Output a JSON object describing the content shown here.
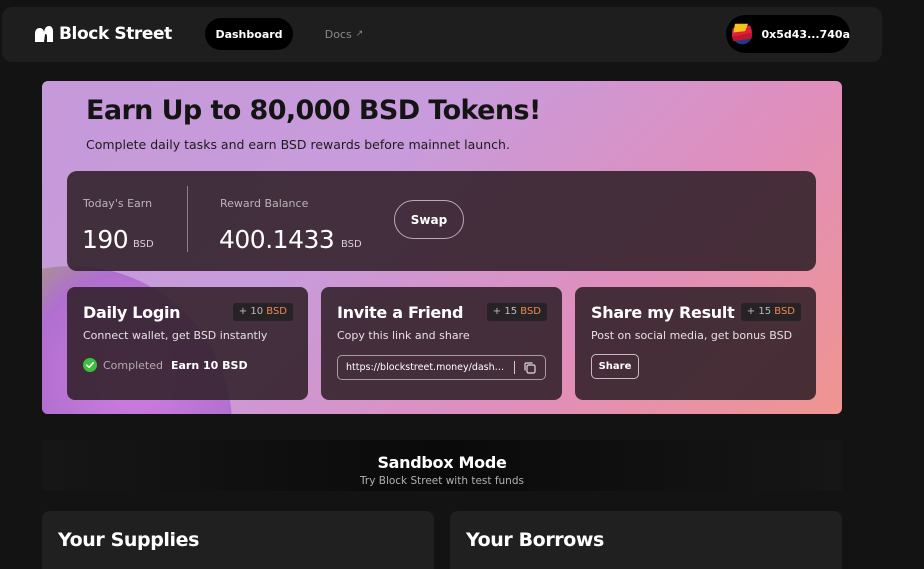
{
  "header": {
    "brand": "Block Street",
    "nav": {
      "dashboard": "Dashboard",
      "docs": "Docs"
    },
    "docs_arrow": "↗",
    "wallet_address": "0x5d43...740a"
  },
  "hero": {
    "title": "Earn Up to 80,000 BSD Tokens!",
    "subtitle": "Complete daily tasks and earn BSD rewards before mainnet launch.",
    "todays_earn": {
      "label": "Today's Earn",
      "value": "190",
      "unit": "BSD"
    },
    "reward_balance": {
      "label": "Reward Balance",
      "value": "400.1433",
      "unit": "BSD"
    },
    "swap_label": "Swap"
  },
  "tasks": {
    "daily_login": {
      "title": "Daily Login",
      "badge_amount": "+ 10",
      "badge_unit": "BSD",
      "description": "Connect wallet, get BSD instantly",
      "status": "Completed",
      "reward": "Earn 10 BSD"
    },
    "invite_friend": {
      "title": "Invite a Friend",
      "badge_amount": "+ 15",
      "badge_unit": "BSD",
      "description": "Copy this link and share",
      "link": "https://blockstreet.money/dashboard"
    },
    "share_result": {
      "title": "Share my Result",
      "badge_amount": "+ 15",
      "badge_unit": "BSD",
      "description": "Post on social media, get bonus BSD",
      "share_label": "Share"
    }
  },
  "sandbox": {
    "title": "Sandbox Mode",
    "subtitle": "Try Block Street with test funds"
  },
  "panels": {
    "supplies_title": "Your Supplies",
    "borrows_title": "Your Borrows"
  },
  "colors": {
    "background": "#131313",
    "accent_orange": "#f08a50",
    "success_green": "#3fbf3f"
  }
}
